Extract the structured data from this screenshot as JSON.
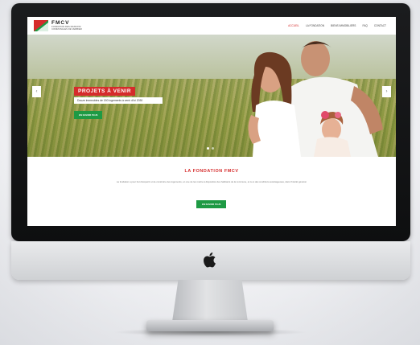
{
  "site": {
    "brand_name": "FMCV",
    "brand_tagline": "FONDATION DES MAISONS COMMUNALES DE VERBIER",
    "colors": {
      "accent": "#d52b2b",
      "cta": "#1e9a44"
    }
  },
  "nav": {
    "items": [
      {
        "label": "ACCUEIL",
        "active": true
      },
      {
        "label": "LA FONDATION",
        "active": false
      },
      {
        "label": "BIENS IMMOBILIERS",
        "active": false
      },
      {
        "label": "FAQ",
        "active": false
      },
      {
        "label": "CONTACT",
        "active": false
      }
    ]
  },
  "hero": {
    "title": "PROJETS À VENIR",
    "subtitle": "Douze immeubles de 150 logements à venir d'ici 2030",
    "cta_label": "EN SAVOIR PLUS",
    "prev_icon": "chevron-left-icon",
    "next_icon": "chevron-right-icon",
    "prev_glyph": "‹",
    "next_glyph": "›"
  },
  "content": {
    "title": "LA FONDATION FMCV",
    "text": "La fondation a pour but d'acquérir et de construire des logements, en vue de les mettre à disposition des habitants de la commune, et ce à des conditions avantageuses, dans l'intérêt général.",
    "cta_label": "EN SAVOIR PLUS"
  },
  "device": {
    "logo_icon": "apple-logo-icon"
  }
}
